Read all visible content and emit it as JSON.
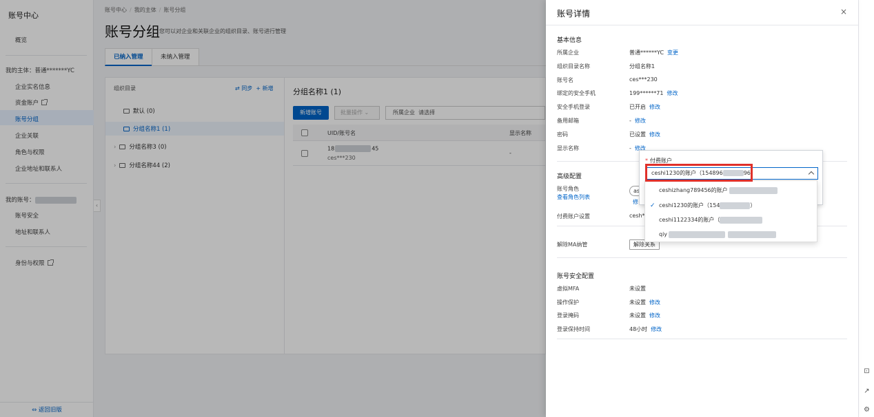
{
  "nav": {
    "title": "账号中心",
    "overview": "概览",
    "my_entity": "我的主体：普通*******YC",
    "items": [
      "企业实名信息",
      "资金账户",
      "账号分组",
      "企业关联",
      "角色与权限",
      "企业地址和联系人"
    ],
    "my_account_label": "我的账号：",
    "account_items": [
      "账号安全",
      "地址和联系人"
    ],
    "identity": "身份与权限",
    "back": "返回旧版",
    "active_item": "账号分组"
  },
  "breadcrumb": [
    "账号中心",
    "我的主体",
    "账号分组"
  ],
  "page": {
    "title": "账号分组",
    "desc": "您可以对企业和关联企业的组织目录、账号进行管理"
  },
  "tabs": [
    "已纳入管理",
    "未纳入管理"
  ],
  "tree": {
    "header": "组织目录",
    "sync": "同步",
    "add": "+ 新增",
    "nodes": [
      "默认 (0)",
      "分组名称1 (1)",
      "分组名称3 (0)",
      "分组名称44 (2)"
    ]
  },
  "list": {
    "title": "分组名称1 (1)",
    "new_button": "新增账号",
    "batch": "批量操作",
    "filter_label": "所属企业",
    "filter_placeholder": "请选择",
    "col_uid": "UID/账号名",
    "col_display": "显示名称",
    "row": {
      "uid_start": "18",
      "uid_end": "45",
      "name": "ces***230",
      "display": "-"
    }
  },
  "drawer": {
    "title": "账号详情",
    "close": "×",
    "basic": "基本信息",
    "fields": [
      {
        "label": "所属企业",
        "value": "普通******YC",
        "link": "变更"
      },
      {
        "label": "组织目录名称",
        "value": "分组名称1",
        "link": ""
      },
      {
        "label": "账号名",
        "value": "ces***230",
        "link": ""
      },
      {
        "label": "绑定的安全手机",
        "value": "199******71",
        "link": "修改"
      },
      {
        "label": "安全手机登录",
        "value": "已开启",
        "link": "修改"
      },
      {
        "label": "备用邮箱",
        "value": "-",
        "link": "修改"
      },
      {
        "label": "密码",
        "value": "已设置",
        "link": "修改"
      },
      {
        "label": "显示名称",
        "value": "-",
        "link": "修改"
      }
    ],
    "advanced": "高级配置",
    "role_label": "账号角色",
    "role_link": "查看角色列表",
    "role_value": "as",
    "role_edit": "修",
    "pay_label": "付费账户设置",
    "pay_value": "cesh***",
    "unbind_label": "解除MA纳管",
    "unbind_button": "解除关系",
    "security": "账号安全配置",
    "sec_fields": [
      {
        "label": "虚拟MFA",
        "value": "未设置",
        "link": ""
      },
      {
        "label": "操作保护",
        "value": "未设置",
        "link": "修改"
      },
      {
        "label": "登录掩码",
        "value": "未设置",
        "link": "修改"
      },
      {
        "label": "登录保持时间",
        "value": "48小时",
        "link": "修改"
      }
    ]
  },
  "dropdown": {
    "label": "付费账户",
    "selected": "ceshi1230的账户（154896",
    "selected_tail": "96）",
    "options": [
      {
        "text": "ceshizhang789456的账户",
        "checked": false
      },
      {
        "text": "ceshi1230的账户（154",
        "checked": true,
        "tail": "）"
      },
      {
        "text": "ceshi1122334的账户（",
        "checked": false
      },
      {
        "text": "qiy",
        "checked": false
      }
    ]
  },
  "colors": {
    "primary": "#0064c8",
    "highlight": "#e0302a"
  }
}
